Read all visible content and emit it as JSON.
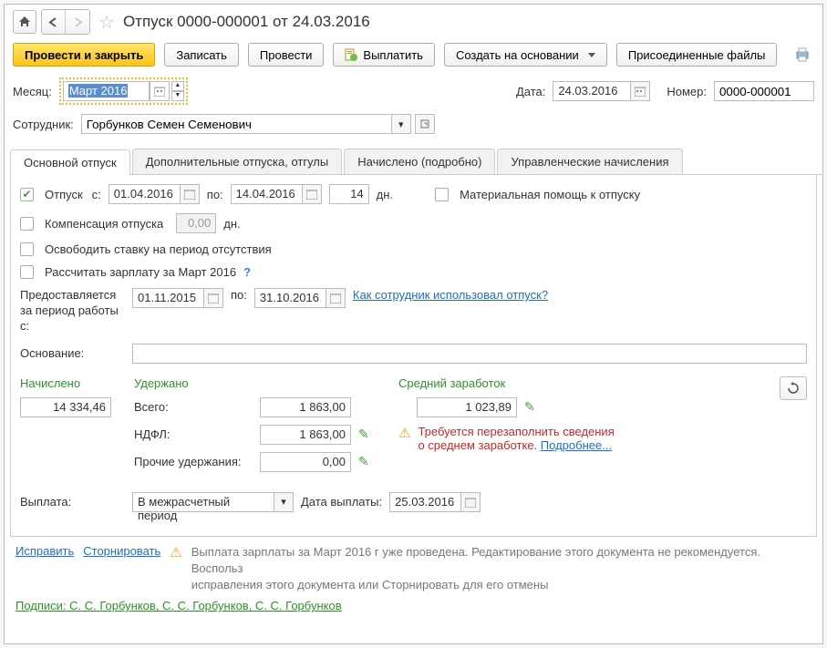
{
  "title": "Отпуск 0000-000001 от 24.03.2016",
  "toolbar": {
    "submit_close": "Провести и закрыть",
    "save": "Записать",
    "submit": "Провести",
    "pay": "Выплатить",
    "create_based": "Создать на основании",
    "attachments": "Присоединенные файлы"
  },
  "form": {
    "month_label": "Месяц:",
    "month_value": "Март 2016",
    "date_label": "Дата:",
    "date_value": "24.03.2016",
    "number_label": "Номер:",
    "number_value": "0000-000001",
    "employee_label": "Сотрудник:",
    "employee_value": "Горбунков Семен Семенович"
  },
  "tabs": {
    "t1": "Основной отпуск",
    "t2": "Дополнительные отпуска, отгулы",
    "t3": "Начислено (подробно)",
    "t4": "Управленческие начисления"
  },
  "main_tab": {
    "vacation_label": "Отпуск",
    "from_label": "с:",
    "from_value": "01.04.2016",
    "to_label": "по:",
    "to_value": "14.04.2016",
    "days_value": "14",
    "days_unit": "дн.",
    "mat_help": "Материальная помощь к отпуску",
    "compensation": "Компенсация отпуска",
    "comp_value": "0,00",
    "comp_unit": "дн.",
    "free_rate": "Освободить ставку на период отсутствия",
    "calc_salary": "Рассчитать зарплату за Март 2016",
    "period_label": "Предоставляется за период работы с:",
    "period_from": "01.11.2015",
    "period_to_label": "по:",
    "period_to": "31.10.2016",
    "usage_link": "Как сотрудник использовал отпуск?",
    "basis_label": "Основание:",
    "accrued": "Начислено",
    "accrued_value": "14 334,46",
    "withheld": "Удержано",
    "total_label": "Всего:",
    "total_value": "1 863,00",
    "ndfl_label": "НДФЛ:",
    "ndfl_value": "1 863,00",
    "other_label": "Прочие удержания:",
    "other_value": "0,00",
    "avg_label": "Средний заработок",
    "avg_value": "1 023,89",
    "warning1": "Требуется перезаполнить сведения",
    "warning2": "о среднем заработке. ",
    "warning_link": "Подробнее...",
    "payout_label": "Выплата:",
    "payout_mode": "В межрасчетный период",
    "payout_date_label": "Дата выплаты:",
    "payout_date": "25.03.2016"
  },
  "footer": {
    "fix": "Исправить",
    "reverse": "Сторнировать",
    "warn1": "Выплата зарплаты за Март 2016 г уже проведена. Редактирование этого документа не рекомендуется. Воспольз",
    "warn2": "исправления этого документа или Сторнировать для его отмены",
    "signatures": "Подписи: С. С. Горбунков, С. С. Горбунков, С. С. Горбунков"
  }
}
